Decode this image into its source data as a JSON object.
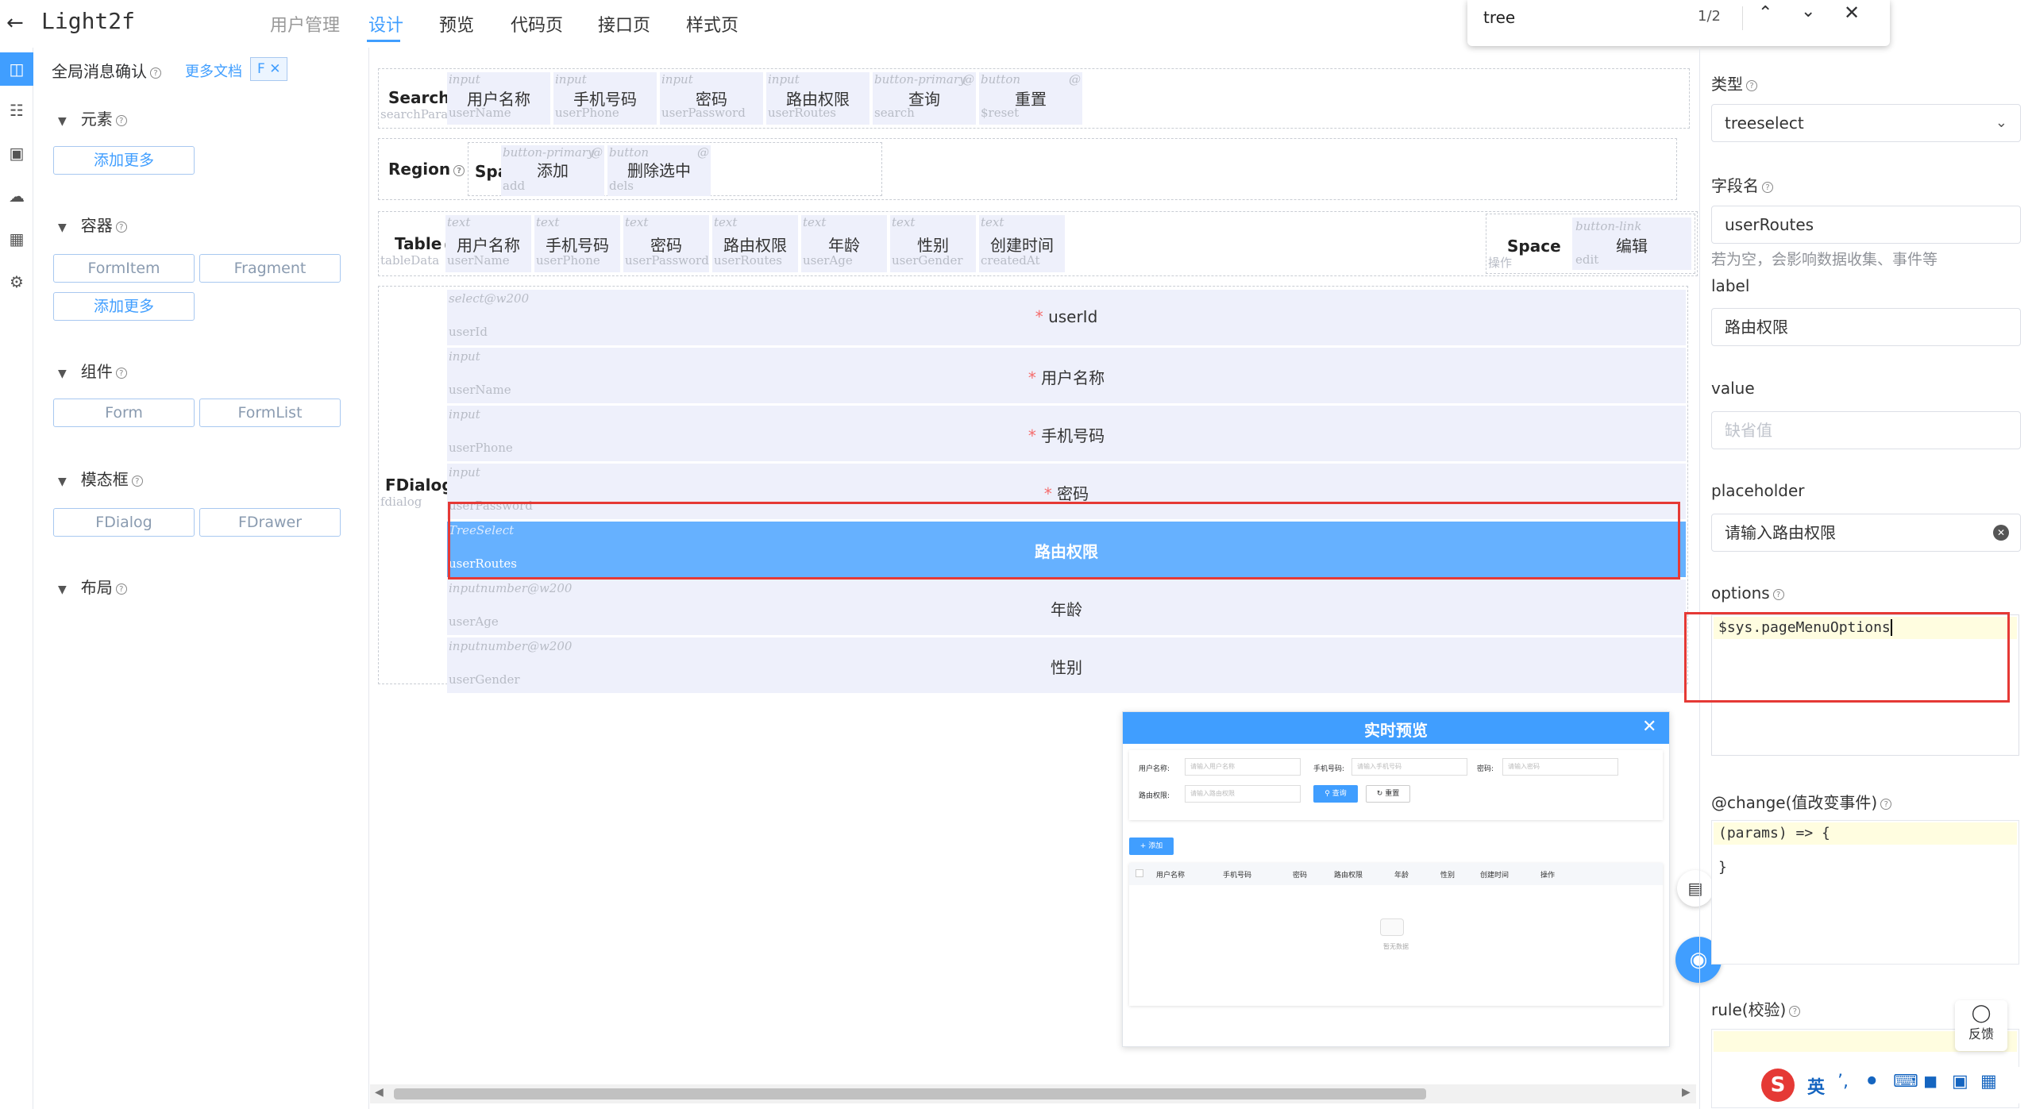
{
  "app": {
    "title": "Light2f",
    "back_icon": "arrow-left-icon"
  },
  "nav": {
    "tabs": [
      "用户管理",
      "设计",
      "预览",
      "代码页",
      "接口页",
      "样式页"
    ],
    "active": 1
  },
  "find": {
    "query": "tree",
    "count": "1/2"
  },
  "panel": {
    "global": "全局消息确认",
    "more_docs": "更多文档",
    "tag": "F",
    "sections": {
      "elements": "元素",
      "containers": "容器",
      "components": "组件",
      "modals": "模态框",
      "layout": "布局"
    },
    "add_more": "添加更多",
    "container_items": [
      "FormItem",
      "Fragment"
    ],
    "component_items": [
      "Form",
      "FormList"
    ],
    "modal_items": [
      "FDialog",
      "FDrawer"
    ]
  },
  "canvas": {
    "search": {
      "title": "Search",
      "sub": "searchPara...",
      "cells": [
        {
          "type": "input",
          "label": "用户名称",
          "field": "userName"
        },
        {
          "type": "input",
          "label": "手机号码",
          "field": "userPhone"
        },
        {
          "type": "input",
          "label": "密码",
          "field": "userPassword"
        },
        {
          "type": "input",
          "label": "路由权限",
          "field": "userRoutes"
        },
        {
          "type": "button-primary",
          "label": "查询",
          "field": "search"
        },
        {
          "type": "button",
          "label": "重置",
          "field": "$reset"
        }
      ]
    },
    "region": {
      "title": "Region",
      "space": "Space",
      "cells": [
        {
          "type": "button-primary",
          "label": "添加",
          "field": "add"
        },
        {
          "type": "button",
          "label": "删除选中",
          "field": "dels"
        }
      ]
    },
    "table": {
      "title": "Table",
      "sub": "tableData",
      "cells": [
        {
          "type": "text",
          "label": "用户名称",
          "field": "userName"
        },
        {
          "type": "text",
          "label": "手机号码",
          "field": "userPhone"
        },
        {
          "type": "text",
          "label": "密码",
          "field": "userPassword"
        },
        {
          "type": "text",
          "label": "路由权限",
          "field": "userRoutes"
        },
        {
          "type": "text",
          "label": "年龄",
          "field": "userAge"
        },
        {
          "type": "text",
          "label": "性别",
          "field": "userGender"
        },
        {
          "type": "text",
          "label": "创建时间",
          "field": "createdAt"
        }
      ],
      "space": {
        "title": "Space",
        "sub": "操作",
        "type": "button-link",
        "label": "编辑",
        "field": "edit"
      }
    },
    "dialog": {
      "title": "FDialog",
      "sub": "fdialog",
      "rows": [
        {
          "type": "select@w200",
          "label": "userId",
          "field": "userId",
          "required": true
        },
        {
          "type": "input",
          "label": "用户名称",
          "field": "userName",
          "required": true
        },
        {
          "type": "input",
          "label": "手机号码",
          "field": "userPhone",
          "required": true
        },
        {
          "type": "input",
          "label": "密码",
          "field": "userPassword",
          "required": true
        },
        {
          "type": "TreeSelect",
          "label": "路由权限",
          "field": "userRoutes",
          "required": false,
          "selected": true
        },
        {
          "type": "inputnumber@w200",
          "label": "年龄",
          "field": "userAge",
          "required": false
        },
        {
          "type": "inputnumber@w200",
          "label": "性别",
          "field": "userGender",
          "required": false
        }
      ]
    }
  },
  "props": {
    "type_label": "类型",
    "type_value": "treeselect",
    "field_label": "字段名",
    "field_value": "userRoutes",
    "field_hint": "若为空，会影响数据收集、事件等",
    "label_label": "label",
    "label_value": "路由权限",
    "value_label": "value",
    "value_placeholder": "缺省值",
    "placeholder_label": "placeholder",
    "placeholder_value": "请输入路由权限",
    "options_label": "options",
    "options_value": "$sys.pageMenuOptions",
    "change_label": "@change(值改变事件)",
    "change_line1": "(params) => {",
    "change_line2": "}",
    "rule_label": "rule(校验)"
  },
  "preview": {
    "title": "实时预览",
    "labels": {
      "username": "用户名称:",
      "phone": "手机号码:",
      "password": "密码:",
      "routes": "路由权限:"
    },
    "placeholders": {
      "username": "请输入用户名称",
      "phone": "请输入手机号码",
      "password": "请输入密码",
      "routes": "请输入路由权限"
    },
    "search_btn": "查询",
    "reset_btn": "重置",
    "add_btn": "+ 添加",
    "columns": [
      "用户名称",
      "手机号码",
      "密码",
      "路由权限",
      "年龄",
      "性别",
      "创建时间",
      "操作"
    ],
    "empty": "暂无数据"
  },
  "feedback": "反馈",
  "ime": {
    "lang": "英"
  },
  "colors": {
    "accent": "#409eff",
    "selected": "#66b1ff",
    "highlight": "#e53935"
  }
}
